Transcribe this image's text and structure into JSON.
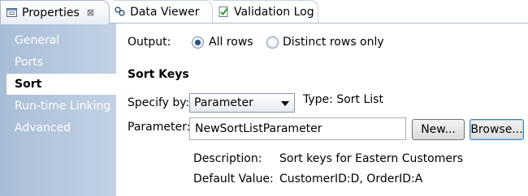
{
  "tabs": [
    {
      "label": "Properties",
      "icon": "properties-icon",
      "close": "⊠"
    },
    {
      "label": "Data Viewer",
      "icon": "data-viewer-icon"
    },
    {
      "label": "Validation Log",
      "icon": "validation-log-icon"
    }
  ],
  "sidebar": {
    "items": [
      {
        "label": "General"
      },
      {
        "label": "Ports"
      },
      {
        "label": "Sort"
      },
      {
        "label": "Run-time Linking"
      },
      {
        "label": "Advanced"
      }
    ]
  },
  "output": {
    "label": "Output:",
    "options": [
      {
        "label": "All rows",
        "selected": true
      },
      {
        "label": "Distinct rows only",
        "selected": false
      }
    ]
  },
  "sort_keys": {
    "heading": "Sort Keys",
    "specify_label": "Specify by:",
    "specify_value": "Parameter",
    "type_text": "Type: Sort List",
    "parameter_label": "Parameter:",
    "parameter_value": "NewSortListParameter",
    "new_button": "New...",
    "browse_button": "Browse...",
    "description_label": "Description:",
    "description_value": "Sort keys for Eastern Customers",
    "default_label": "Default Value:",
    "default_value": "CustomerID:D, OrderID:A"
  }
}
